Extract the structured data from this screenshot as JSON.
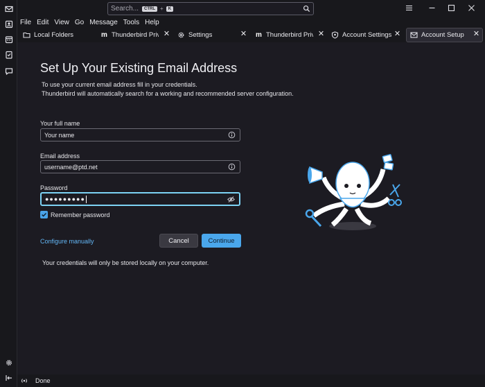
{
  "titlebar": {
    "search_placeholder": "Search...",
    "shortcut_key1": "CTRL",
    "shortcut_plus": "+",
    "shortcut_key2": "K"
  },
  "menu": [
    "File",
    "Edit",
    "View",
    "Go",
    "Message",
    "Tools",
    "Help"
  ],
  "tabs": [
    {
      "label": "Local Folders",
      "icon": "folder-icon",
      "closable": false
    },
    {
      "label": "Thunderbird Privac",
      "icon": "mozilla-m-icon",
      "closable": true
    },
    {
      "label": "Settings",
      "icon": "gear-icon",
      "closable": true
    },
    {
      "label": "Thunderbird Privac",
      "icon": "mozilla-m-icon",
      "closable": true
    },
    {
      "label": "Account Settings",
      "icon": "account-shield-icon",
      "closable": true
    },
    {
      "label": "Account Setup",
      "icon": "mail-setup-icon",
      "closable": true,
      "active": true
    }
  ],
  "page": {
    "title": "Set Up Your Existing Email Address",
    "description_line1": "To use your current email address fill in your credentials.",
    "description_line2": "Thunderbird will automatically search for a working and recommended server configuration.",
    "full_name_label": "Your full name",
    "full_name_value": "Your name",
    "email_label": "Email address",
    "email_value": "username@ptd.net",
    "password_label": "Password",
    "password_value": "●●●●●●●●●",
    "remember_label": "Remember password",
    "remember_checked": true,
    "configure_link": "Configure manually",
    "cancel_label": "Cancel",
    "continue_label": "Continue",
    "footnote": "Your credentials will only be stored locally on your computer."
  },
  "status": {
    "text": "Done"
  },
  "colors": {
    "accent": "#4aa7ec",
    "link": "#63b6f5",
    "focus": "#7dd3f5",
    "background": "#1c1b22"
  }
}
